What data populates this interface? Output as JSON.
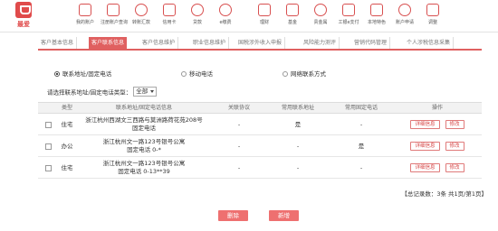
{
  "brand": {
    "label": "最爱"
  },
  "nav": [
    {
      "label": "我的账户",
      "icon": "account-icon"
    },
    {
      "label": "注册账户查询",
      "icon": "register-query-icon"
    },
    {
      "label": "转账汇款",
      "icon": "transfer-icon"
    },
    {
      "label": "信用卡",
      "icon": "credit-card-icon"
    },
    {
      "label": "贷款",
      "icon": "loan-icon"
    },
    {
      "label": "e缴费",
      "icon": "payment-icon"
    },
    {
      "label": "理财",
      "icon": "finance-icon"
    },
    {
      "label": "基金",
      "icon": "fund-icon"
    },
    {
      "label": "贵金属",
      "icon": "precious-metal-icon"
    },
    {
      "label": "工银e支付",
      "icon": "epay-icon"
    },
    {
      "label": "本地特色",
      "icon": "local-feature-icon"
    },
    {
      "label": "账户申请",
      "icon": "account-apply-icon"
    },
    {
      "label": "调整",
      "icon": "adjust-icon"
    }
  ],
  "tabs": [
    {
      "label": "客户基本信息"
    },
    {
      "label": "客户联系信息"
    },
    {
      "label": "客户信息维护"
    },
    {
      "label": "职业信息维护"
    },
    {
      "label": "国税涉外收入申报"
    },
    {
      "label": "风险能力测评"
    },
    {
      "label": "营销代码管理"
    },
    {
      "label": "个人涉税信息采集"
    }
  ],
  "contact_type_radios": [
    {
      "label": "联系地址/固定电话",
      "checked": true
    },
    {
      "label": "移动电话",
      "checked": false
    },
    {
      "label": "网络联系方式",
      "checked": false
    }
  ],
  "type_filter": {
    "label": "请选择联系地址/固定电话类型：",
    "value": "全部"
  },
  "table": {
    "headers": [
      "类型",
      "联系地址/固定电话信息",
      "关联协议",
      "常用联系地址",
      "常用固定电话",
      "操作"
    ],
    "rows": [
      {
        "type": "住宅",
        "info": [
          "浙江杭州西湖文三西路与莫洲路荷花苑208号",
          "固定电话"
        ],
        "agreement": "-",
        "common_address": "是",
        "common_phone": "-"
      },
      {
        "type": "办公",
        "info": [
          "浙江杭州文一路123号银号公寓",
          "固定电话 0-*"
        ],
        "agreement": "-",
        "common_address": "-",
        "common_phone": "是"
      },
      {
        "type": "住宅",
        "info": [
          "浙江杭州文一路123号银号公寓",
          "固定电话 0-13**39"
        ],
        "agreement": "-",
        "common_address": "-",
        "common_phone": "-"
      }
    ],
    "actions": {
      "detail": "详细信息",
      "edit": "修改"
    }
  },
  "summary": "【总记录数：3条 共1页/第1页】",
  "buttons": {
    "delete": "删除",
    "add": "新增"
  },
  "colors": {
    "accent": "#e06060",
    "button": "#ee7070"
  }
}
